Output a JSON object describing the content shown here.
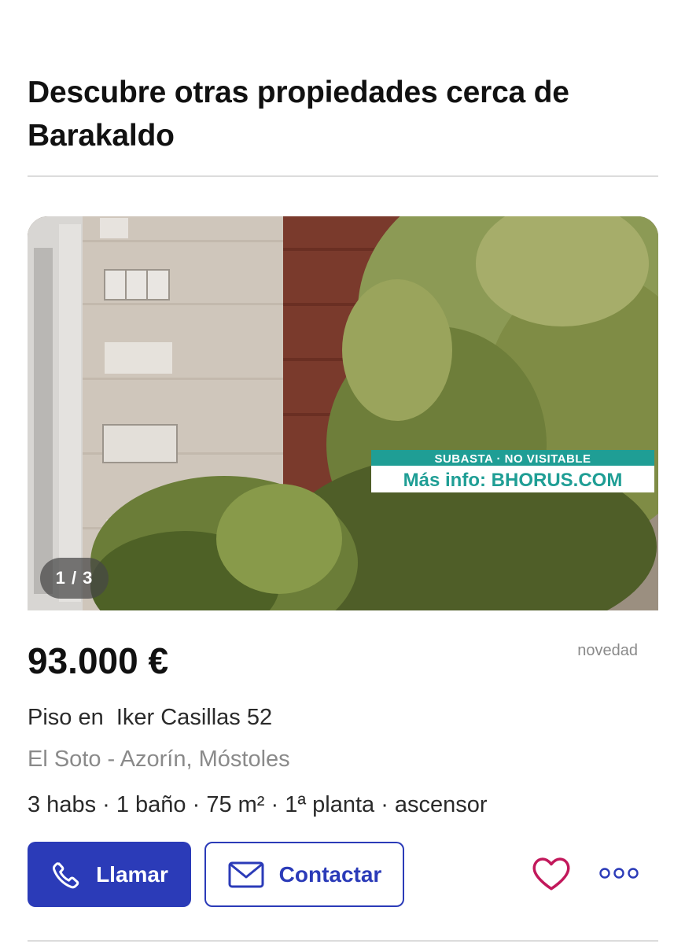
{
  "section": {
    "title": "Descubre otras propiedades cerca de Barakaldo"
  },
  "listing": {
    "photo": {
      "counter": "1 / 3",
      "overlay_line1": "SUBASTA · NO VISITABLE",
      "overlay_line2": "Más info: BHORUS.COM"
    },
    "price": "93.000 €",
    "badge": "novedad",
    "title": "Piso en  Iker Casillas 52",
    "location": "El Soto - Azorín, Móstoles",
    "features": "3 habs · 1 baño · 75 m² · 1ª planta · ascensor"
  },
  "actions": {
    "call_label": "Llamar",
    "contact_label": "Contactar",
    "favorite_icon": "heart-icon",
    "more_icon": "more-options-icon"
  },
  "colors": {
    "primary": "#2b3bb8",
    "favorite": "#c2185b",
    "muted_text": "#8a8a8a",
    "overlay_teal": "#1f9e95"
  }
}
